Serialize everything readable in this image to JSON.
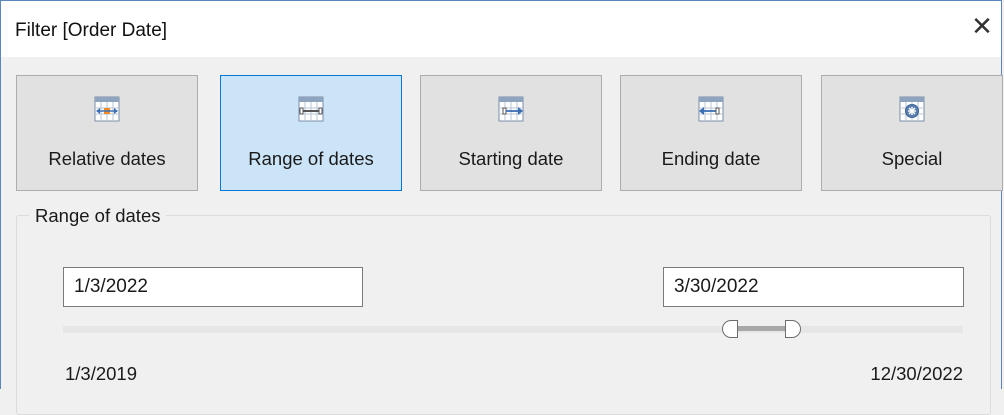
{
  "window": {
    "title": "Filter [Order Date]"
  },
  "filter_types": [
    {
      "label": "Relative dates",
      "icon": "relative-dates-icon",
      "active": false
    },
    {
      "label": "Range of dates",
      "icon": "range-of-dates-icon",
      "active": true
    },
    {
      "label": "Starting date",
      "icon": "starting-date-icon",
      "active": false
    },
    {
      "label": "Ending date",
      "icon": "ending-date-icon",
      "active": false
    },
    {
      "label": "Special",
      "icon": "special-icon",
      "active": false
    }
  ],
  "range": {
    "group_label": "Range of dates",
    "start_value": "1/3/2022",
    "end_value": "3/30/2022",
    "min_label": "1/3/2019",
    "max_label": "12/30/2022"
  },
  "colors": {
    "active_button_bg": "#cce4f7",
    "active_button_border": "#0078d7",
    "window_border": "#5a86b9"
  }
}
